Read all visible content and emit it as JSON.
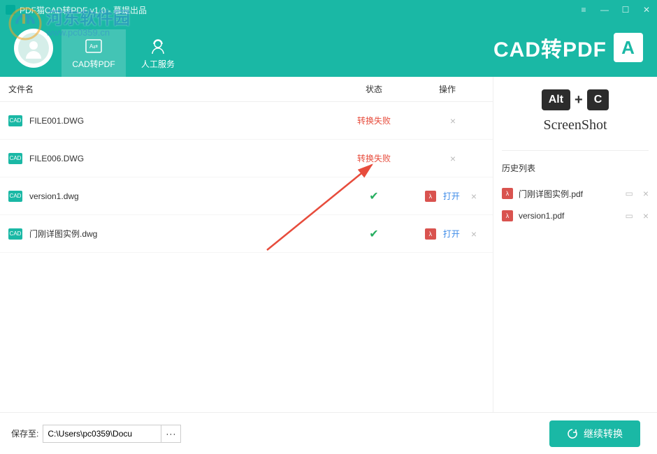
{
  "titlebar": {
    "title": "PDF猫CAD转PDF v1.0 - 暮提出品"
  },
  "tabs": {
    "cad2pdf": "CAD转PDF",
    "service": "人工服务"
  },
  "brand": {
    "text": "CAD转PDF",
    "badge": "A"
  },
  "columns": {
    "name": "文件名",
    "status": "状态",
    "op": "操作"
  },
  "files": [
    {
      "icon": "CAD",
      "name": "FILE001.DWG",
      "status": "fail",
      "statusText": "转换失败"
    },
    {
      "icon": "CAD",
      "name": "FILE006.DWG",
      "status": "fail",
      "statusText": "转换失败"
    },
    {
      "icon": "CAD",
      "name": "version1.dwg",
      "status": "ok",
      "statusText": "✓",
      "open": "打开"
    },
    {
      "icon": "CAD",
      "name": "门刚详图实例.dwg",
      "status": "ok",
      "statusText": "✓",
      "open": "打开"
    }
  ],
  "promo": {
    "key1": "Alt",
    "key2": "C",
    "label": "ScreenShot"
  },
  "history": {
    "title": "历史列表",
    "items": [
      {
        "name": "门刚详图实例.pdf"
      },
      {
        "name": "version1.pdf"
      }
    ]
  },
  "footer": {
    "saveLabel": "保存至:",
    "path": "C:\\Users\\pc0359\\Docu",
    "browse": "···",
    "convert": "继续转换"
  },
  "watermark": {
    "text": "河东软件园",
    "url": "www.pc0359.cn"
  }
}
